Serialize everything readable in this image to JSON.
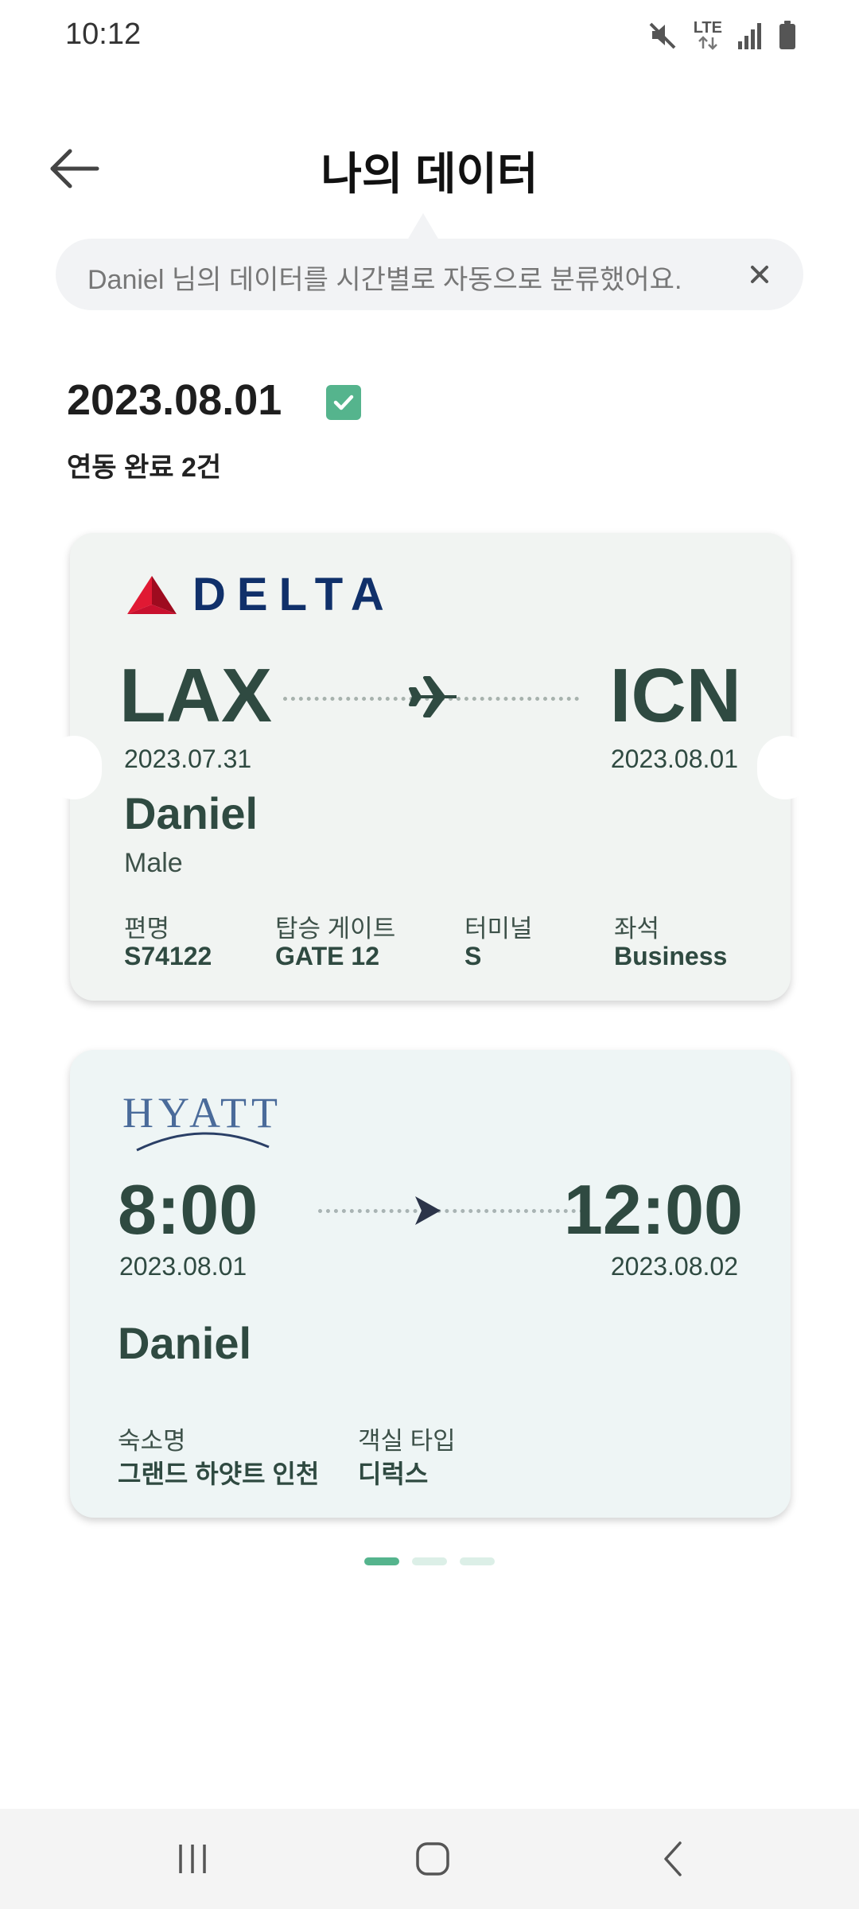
{
  "status_bar": {
    "time": "10:12",
    "network_label": "LTE",
    "icons": [
      "mute-icon",
      "lte-icon",
      "signal-icon",
      "battery-icon"
    ]
  },
  "header": {
    "title": "나의 데이터",
    "back_icon": "arrow-left-icon"
  },
  "banner": {
    "text": "Daniel 님의 데이터를 시간별로 자동으로 분류했어요.",
    "close_icon": "close-icon"
  },
  "date_section": {
    "date": "2023.08.01",
    "status_icon": "check-icon",
    "subtitle": "연동 완료 2건"
  },
  "flight_card": {
    "airline": "DELTA",
    "from_code": "LAX",
    "to_code": "ICN",
    "from_date": "2023.07.31",
    "to_date": "2023.08.01",
    "passenger_name": "Daniel",
    "passenger_sex": "Male",
    "fields": [
      {
        "label": "편명",
        "value": "S74122"
      },
      {
        "label": "탑승 게이트",
        "value": "GATE 12"
      },
      {
        "label": "터미널",
        "value": "S"
      },
      {
        "label": "좌석",
        "value": "Business"
      }
    ]
  },
  "hotel_card": {
    "brand": "HYATT",
    "checkin_time": "8:00",
    "checkout_time": "12:00",
    "checkin_date": "2023.08.01",
    "checkout_date": "2023.08.02",
    "guest_name": "Daniel",
    "fields": [
      {
        "label": "숙소명",
        "value": "그랜드 하얏트 인천"
      },
      {
        "label": "객실 타입",
        "value": "디럭스"
      }
    ]
  },
  "pagination": {
    "total": 3,
    "active": 1
  },
  "colors": {
    "accent": "#55b48d",
    "card_text": "#2f4a41",
    "delta_blue": "#10306a",
    "delta_red": "#c8102e"
  },
  "nav_bar": {
    "icons": [
      "recent-apps-icon",
      "home-icon",
      "back-icon"
    ]
  }
}
